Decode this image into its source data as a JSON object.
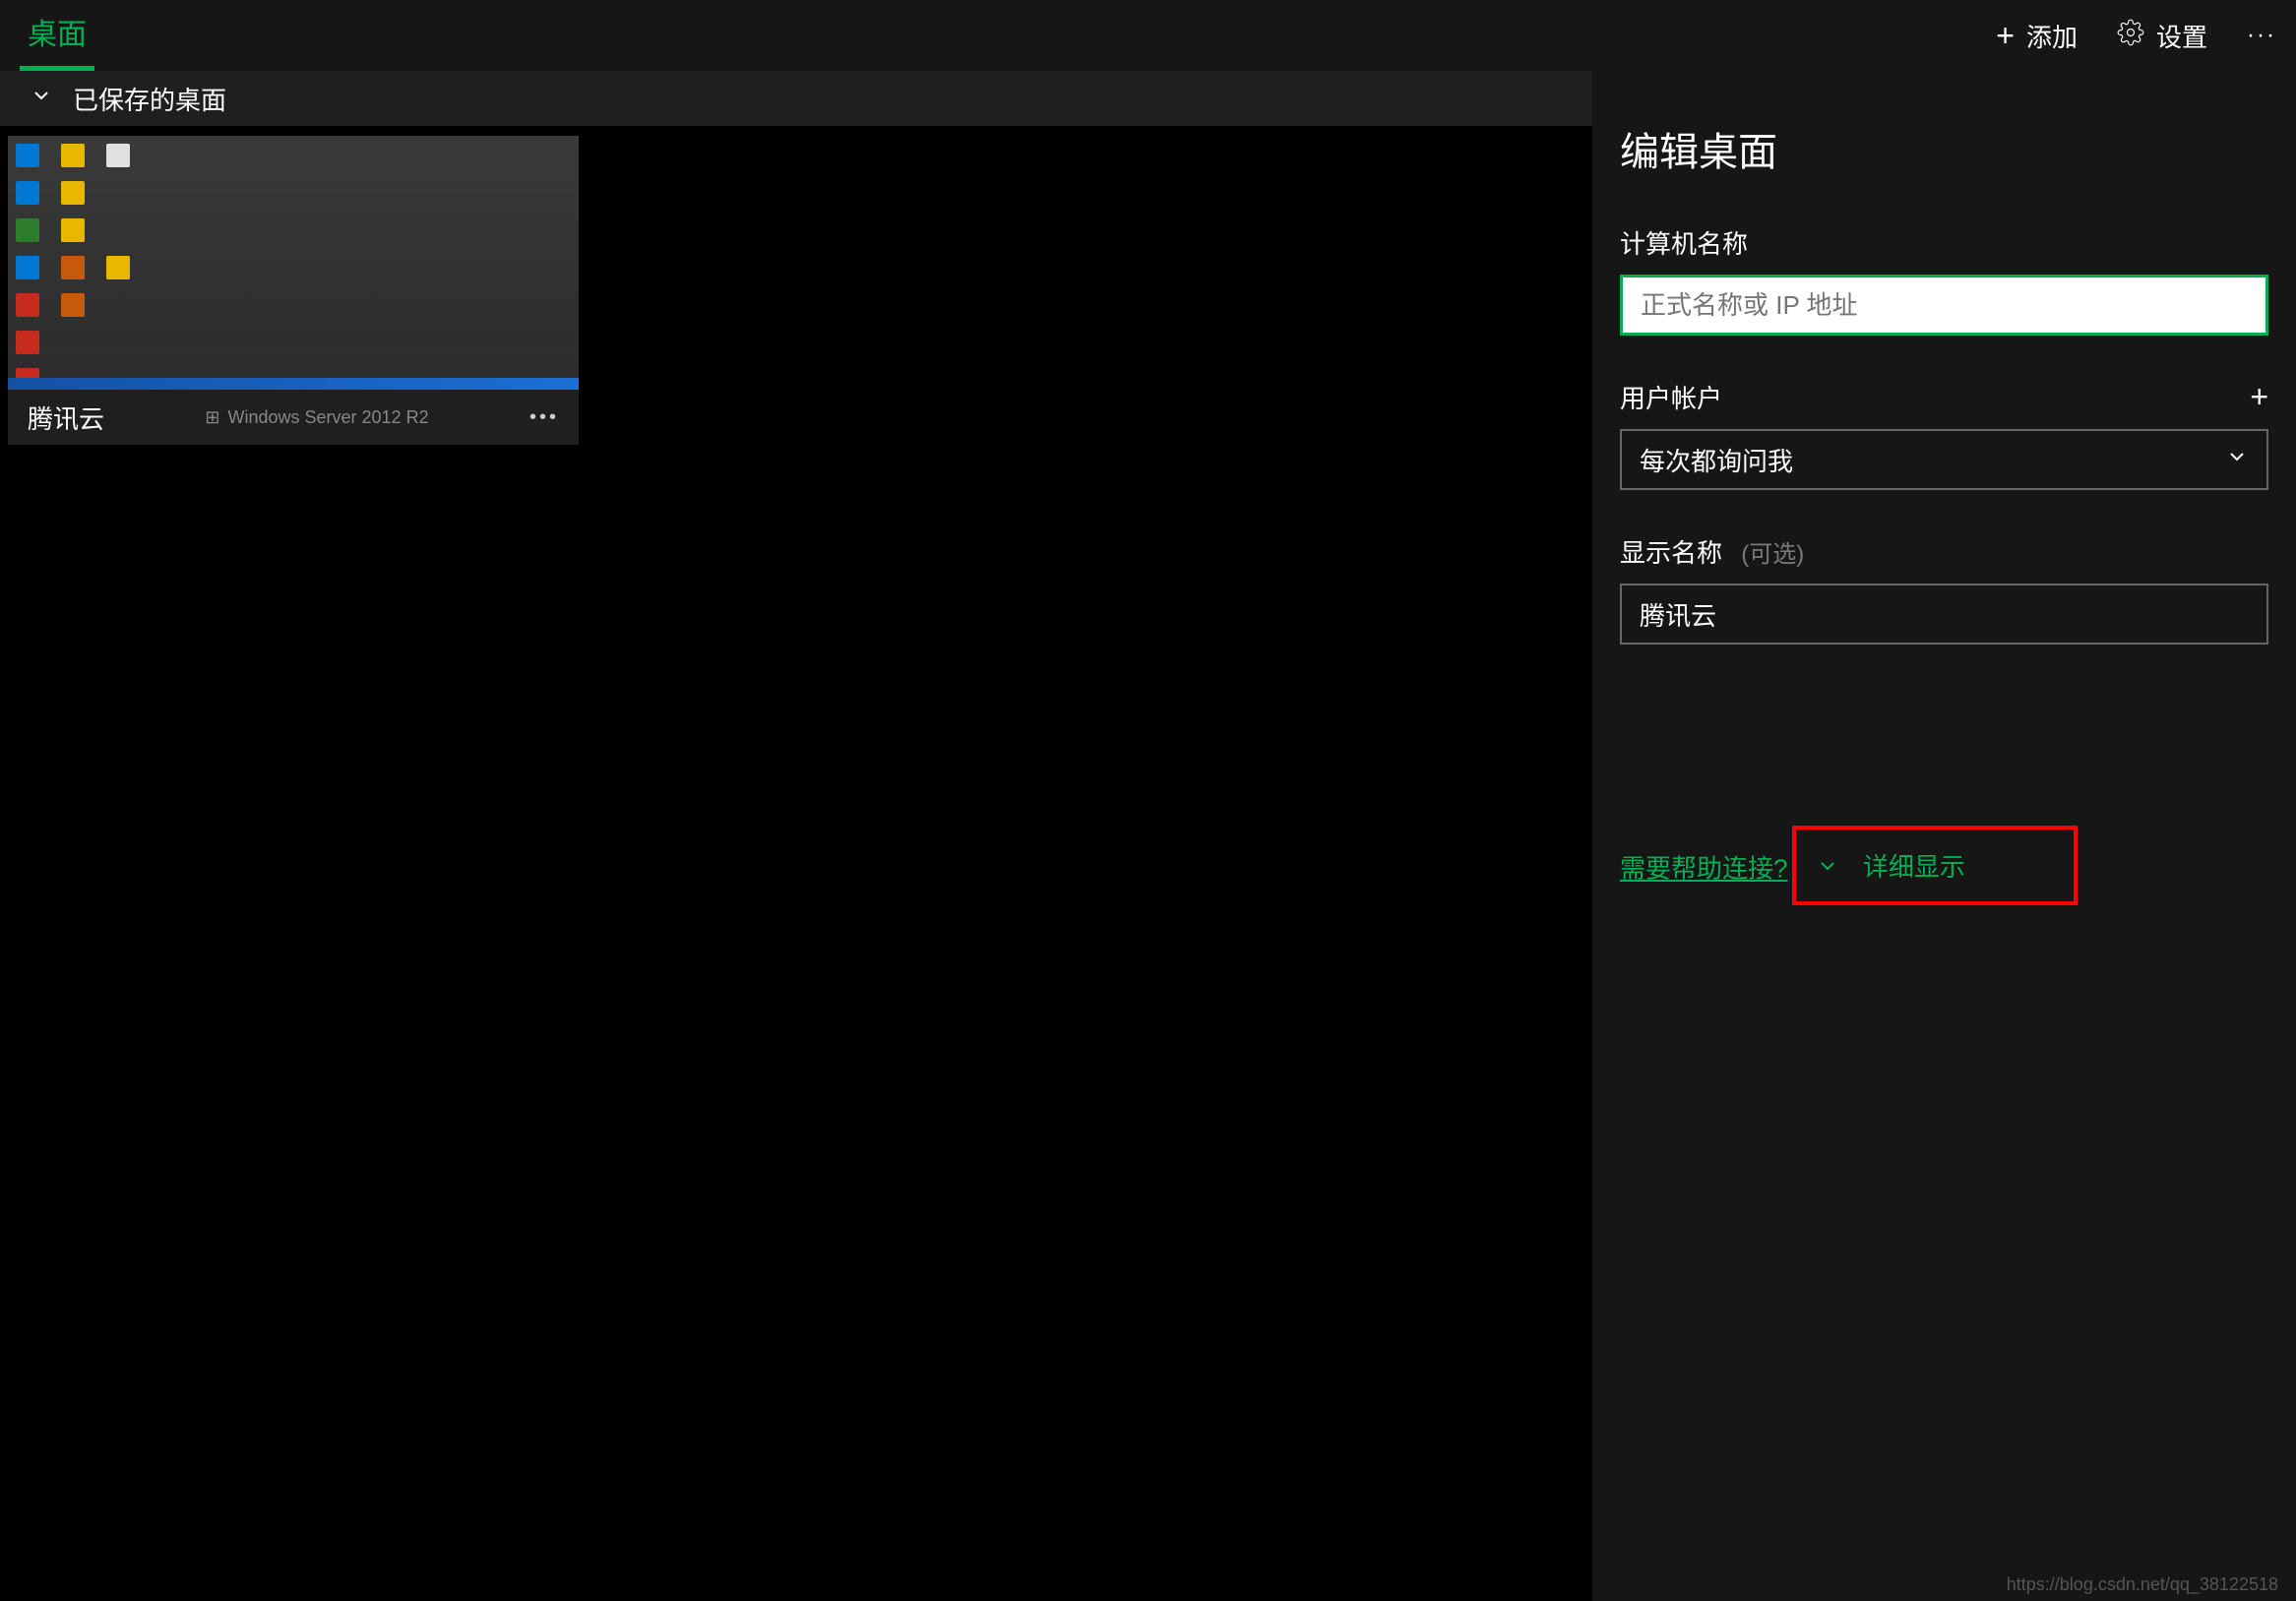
{
  "header": {
    "tab_label": "桌面",
    "add_label": "添加",
    "settings_label": "设置"
  },
  "section": {
    "saved_label": "已保存的桌面"
  },
  "cards": [
    {
      "name": "腾讯云",
      "os_label": "Windows Server 2012 R2"
    }
  ],
  "editor": {
    "title": "编辑桌面",
    "computer_name_label": "计算机名称",
    "computer_name_placeholder": "正式名称或 IP 地址",
    "user_account_label": "用户帐户",
    "user_account_value": "每次都询问我",
    "display_name_label": "显示名称",
    "display_name_optional": "(可选)",
    "display_name_value": "腾讯云",
    "help_link": "需要帮助连接?",
    "details_label": "详细显示"
  },
  "watermark": "https://blog.csdn.net/qq_38122518"
}
